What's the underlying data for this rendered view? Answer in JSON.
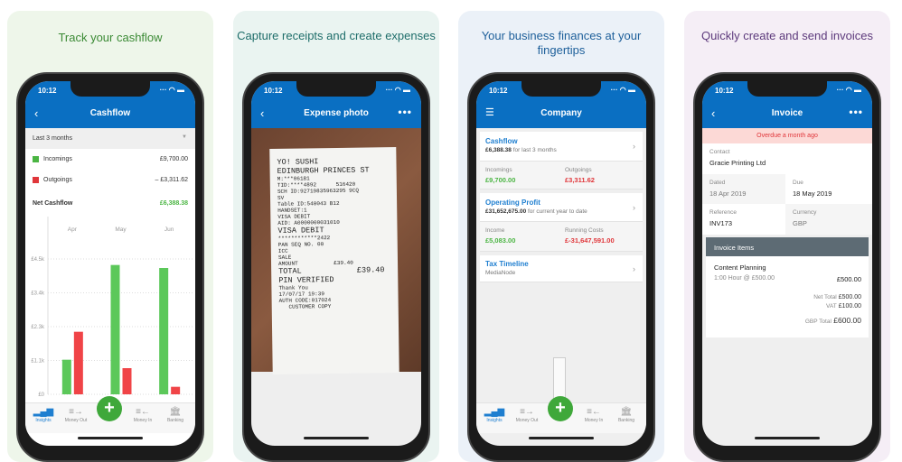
{
  "status_time": "10:12",
  "tabs": [
    "Insights",
    "Money Out",
    "Money In",
    "Banking"
  ],
  "panel1": {
    "caption": "Track your cashflow",
    "title": "Cashflow",
    "period": "Last 3 months",
    "incomings_label": "Incomings",
    "incomings": "£9,700.00",
    "outgoings_label": "Outgoings",
    "outgoings": "– £3,311.62",
    "net_label": "Net Cashflow",
    "net": "£6,388.38"
  },
  "chart_data": {
    "type": "bar",
    "categories": [
      "Apr",
      "May",
      "Jun"
    ],
    "series": [
      {
        "values": [
          1150,
          4300,
          4200
        ],
        "color": "#5cc85a"
      },
      {
        "values": [
          2080,
          870,
          250
        ],
        "color": "#f04447"
      }
    ],
    "yticks": [
      "£0",
      "£1.1k",
      "£2.3k",
      "£3.4k",
      "£4.5k"
    ],
    "ytick_values": [
      0,
      1125,
      2250,
      3375,
      4500
    ],
    "ylim": [
      0,
      4500
    ],
    "grid": true
  },
  "panel2": {
    "caption": "Capture receipts and create expenses",
    "title": "Expense photo",
    "receipt": [
      "YO! SUSHI",
      "EDINBURGH PRINCES ST",
      "M:***06181",
      "TID:****4892      516420",
      "SCH ID:92719835963295 9CQ",
      "SV",
      "Table ID:540043 B12",
      "HANDSET:1",
      "",
      "VISA DEBIT",
      "AID: A0000000031010",
      "VISA DEBIT",
      "",
      "************2422",
      "PAN SEQ NO. 00",
      "ICC",
      "",
      "SALE",
      "AMOUNT           £39.40",
      "TOTAL            £39.40",
      "",
      "PIN VERIFIED",
      "Thank You",
      "",
      "17/07/17 19:39",
      "AUTH CODE:017024",
      "",
      "   CUSTOMER COPY"
    ]
  },
  "panel3": {
    "caption": "Your business finances at your fingertips",
    "title": "Company",
    "cashflow": {
      "title": "Cashflow",
      "amount": "£6,388.38",
      "suffix": "for last 3 months",
      "l1": "Incomings",
      "v1": "£9,700.00",
      "l2": "Outgoings",
      "v2": "£3,311.62"
    },
    "profit": {
      "title": "Operating Profit",
      "amount": "£31,652,675.00",
      "suffix": "for current year to date",
      "l1": "Income",
      "v1": "£5,083.00",
      "l2": "Running Costs",
      "v2": "£-31,647,591.00"
    },
    "tax": {
      "title": "Tax Timeline",
      "sub": "MediaNode"
    }
  },
  "panel4": {
    "caption": "Quickly create and send invoices",
    "title": "Invoice",
    "overdue": "Overdue a month ago",
    "contact_label": "Contact",
    "contact": "Gracie Printing Ltd",
    "dated_label": "Dated",
    "dated": "18 Apr 2019",
    "due_label": "Due",
    "due": "18 May 2019",
    "ref_label": "Reference",
    "ref": "INV173",
    "currency_label": "Currency",
    "currency": "GBP",
    "items_header": "Invoice Items",
    "item_name": "Content Planning",
    "item_desc": "1:00 Hour @ £500.00",
    "item_amount": "£500.00",
    "net_label": "Net Total",
    "net": "£500.00",
    "vat_label": "VAT",
    "vat": "£100.00",
    "total_label": "GBP Total",
    "total": "£600.00"
  }
}
